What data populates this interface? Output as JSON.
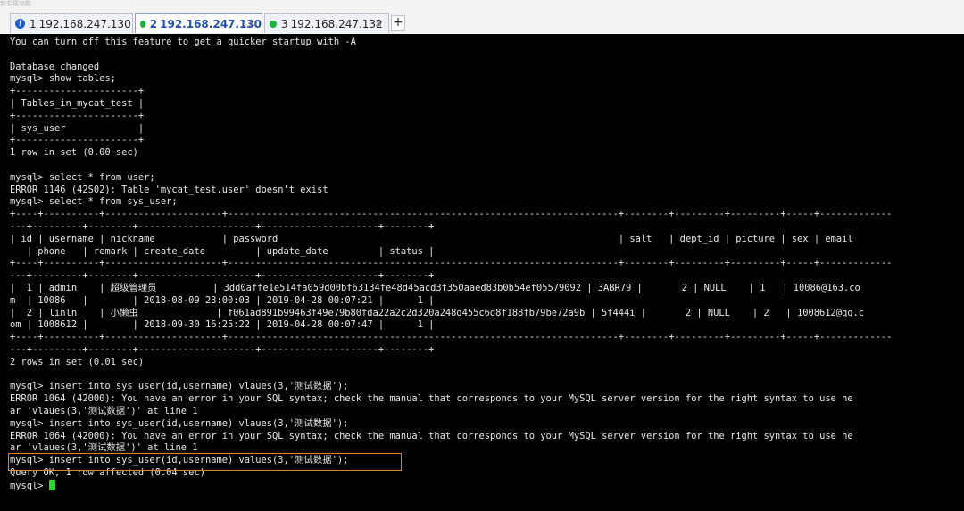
{
  "window": {
    "top_strip_text": "新实现功能"
  },
  "tabs": [
    {
      "number": "1",
      "label": "192.168.247.130",
      "icon": "warning-icon",
      "active": false
    },
    {
      "number": "2",
      "label": "192.168.247.130",
      "icon": "status-ok-icon",
      "active": true
    },
    {
      "number": "3",
      "label": "192.168.247.132",
      "icon": "status-ok-icon",
      "active": false
    }
  ],
  "tab_close": "×",
  "new_tab": "+",
  "terminal": {
    "output": "You can turn off this feature to get a quicker startup with -A\n\nDatabase changed\nmysql> show tables;\n+----------------------+\n| Tables_in_mycat_test |\n+----------------------+\n| sys_user             |\n+----------------------+\n1 row in set (0.00 sec)\n\nmysql> select * from user;\nERROR 1146 (42S02): Table 'mycat_test.user' doesn't exist\nmysql> select * from sys_user;\n+----+----------+---------------------+----------------------------------------------------------------------+--------+---------+---------+-----+-------------\n---+---------+--------+---------------------+---------------------+--------+\n| id | username | nickname            | password                                                             | salt   | dept_id | picture | sex | email\n   | phone   | remark | create_date         | update_date         | status |\n+----+----------+---------------------+----------------------------------------------------------------------+--------+---------+---------+-----+-------------\n---+---------+--------+---------------------+---------------------+--------+\n|  1 | admin    | 超级管理员          | 3dd0affe1e514fa059d00bf63134fe48d45acd3f350aaed83b0b54ef05579092 | 3ABR79 |       2 | NULL    | 1   | 10086@163.co\nm  | 10086   |        | 2018-08-09 23:00:03 | 2019-04-28 00:07:21 |      1 |\n|  2 | linln    | 小懒虫              | f061ad891b99463f49e79b80fda22a2c2d320a248d455c6d8f188fb79be72a9b | 5f444i |       2 | NULL    | 2   | 1008612@qq.c\nom | 1008612 |        | 2018-09-30 16:25:22 | 2019-04-28 00:07:47 |      1 |\n+----+----------+---------------------+----------------------------------------------------------------------+--------+---------+---------+-----+-------------\n---+---------+--------+---------------------+---------------------+--------+\n2 rows in set (0.01 sec)\n\nmysql> insert into sys_user(id,username) vlaues(3,'测试数据');\nERROR 1064 (42000): You have an error in your SQL syntax; check the manual that corresponds to your MySQL server version for the right syntax to use ne\nar 'vlaues(3,'测试数据')' at line 1\nmysql> insert into sys_user(id,username) vlaues(3,'测试数据');\nERROR 1064 (42000): You have an error in your SQL syntax; check the manual that corresponds to your MySQL server version for the right syntax to use ne\nar 'vlaues(3,'测试数据')' at line 1\nmysql> insert into sys_user(id,username) values(3,'测试数据');\nQuery OK, 1 row affected (0.04 sec)\n",
    "prompt": "mysql> "
  }
}
